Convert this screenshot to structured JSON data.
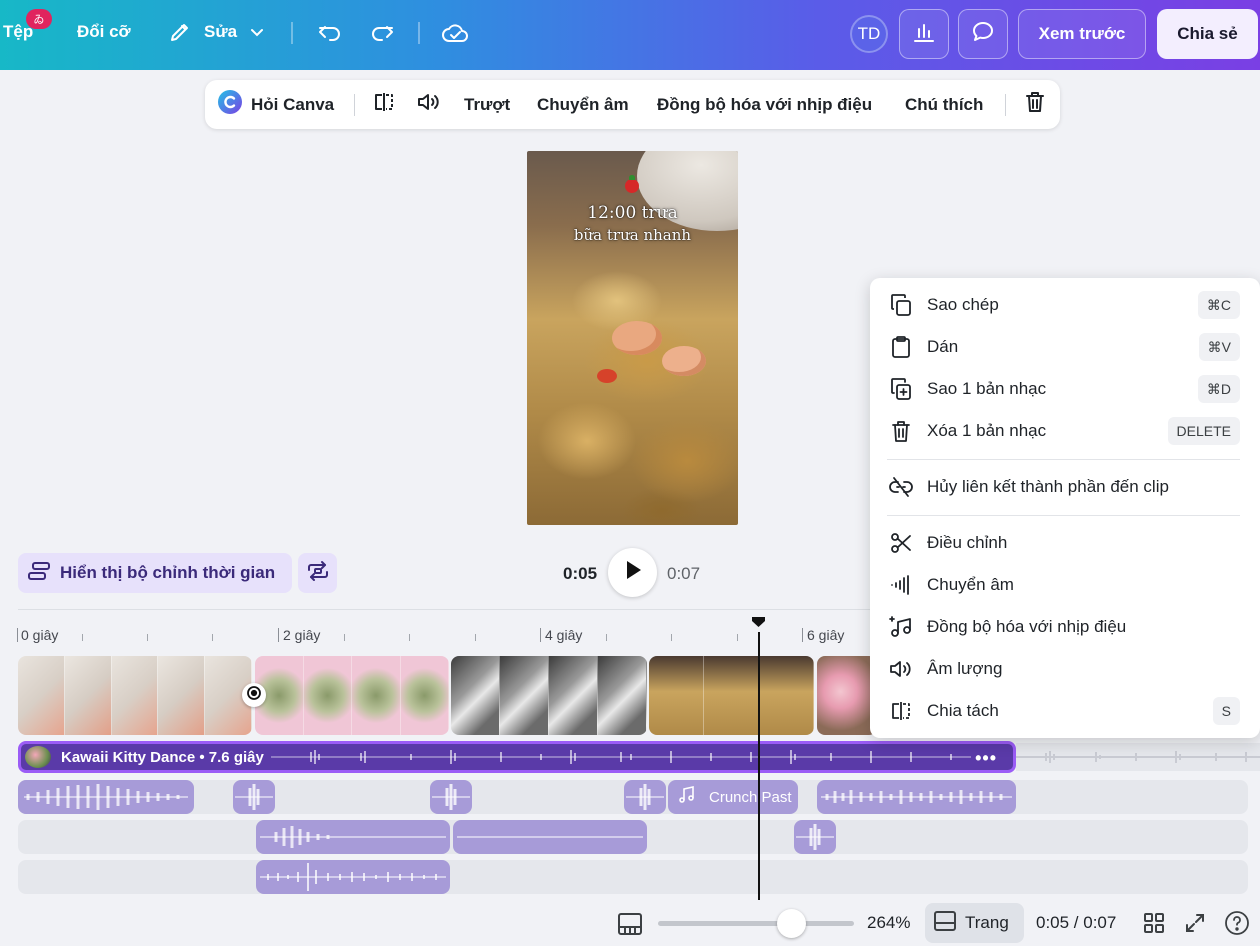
{
  "topbar": {
    "file_label": "Tệp",
    "file_badge": "ゐ",
    "resize_label": "Đổi cỡ",
    "edit_label": "Sửa",
    "avatar_initials": "TD",
    "preview_label": "Xem trước",
    "share_label": "Chia sẻ"
  },
  "context_toolbar": {
    "ask_canva_label": "Hỏi Canva",
    "slide_label": "Trượt",
    "transcribe_label": "Chuyển âm",
    "beat_sync_label": "Đồng bộ hóa với nhịp điệu",
    "caption_label": "Chú thích"
  },
  "preview": {
    "line1": "12:00 trưa",
    "line2": "bữa trưa nhanh"
  },
  "playback": {
    "timeline_toggle_label": "Hiển thị bộ chỉnh thời gian",
    "current_time": "0:05",
    "total_time": "0:07"
  },
  "ruler": {
    "labels": [
      "0 giây",
      "2 giây",
      "4 giây",
      "6 giây"
    ]
  },
  "audio": {
    "main_track_title": "Kawaii Kitty Dance • 7.6 giây",
    "track2_clip_label": "Crunch Past"
  },
  "bottom": {
    "zoom_level": "264%",
    "zoom_fraction": 0.68,
    "page_label": "Trang",
    "time_readout": "0:05 / 0:07"
  },
  "context_menu": {
    "items": [
      {
        "label": "Sao chép",
        "shortcut": "⌘C"
      },
      {
        "label": "Dán",
        "shortcut": "⌘V"
      },
      {
        "label": "Sao 1 bản nhạc",
        "shortcut": "⌘D"
      },
      {
        "label": "Xóa 1 bản nhạc",
        "shortcut": "DELETE"
      },
      {
        "label": "Hủy liên kết thành phần đến clip",
        "shortcut": ""
      },
      {
        "label": "Điều chỉnh",
        "shortcut": ""
      },
      {
        "label": "Chuyển âm",
        "shortcut": ""
      },
      {
        "label": "Đồng bộ hóa với nhịp điệu",
        "shortcut": ""
      },
      {
        "label": "Âm lượng",
        "shortcut": ""
      },
      {
        "label": "Chia tách",
        "shortcut": "S"
      }
    ]
  },
  "colors": {
    "accent_purple": "#7a3fe4",
    "audio_track_main": "#5a3aa8",
    "audio_clip": "#a79bd8"
  }
}
